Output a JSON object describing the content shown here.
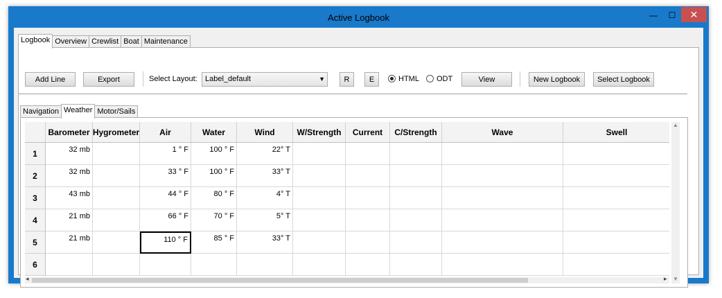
{
  "window": {
    "title": "Active Logbook",
    "minimize": "—",
    "maximize": "☐",
    "close": "✕"
  },
  "tabs": [
    "Logbook",
    "Overview",
    "Crewlist",
    "Boat",
    "Maintenance"
  ],
  "toolbar": {
    "add_line": "Add Line",
    "export": "Export",
    "select_layout_label": "Select Layout:",
    "layout_value": "Label_default",
    "r_button": "R",
    "e_button": "E",
    "html_label": "HTML",
    "odt_label": "ODT",
    "view": "View",
    "new_logbook": "New Logbook",
    "select_logbook": "Select Logbook"
  },
  "subtabs": [
    "Navigation",
    "Weather",
    "Motor/Sails"
  ],
  "grid": {
    "columns": [
      "Barometer",
      "Hygrometer",
      "Air",
      "Water",
      "Wind",
      "W/Strength",
      "Current",
      "C/Strength",
      "Wave",
      "Swell"
    ],
    "rows": [
      {
        "num": "1",
        "cells": [
          "32 mb",
          "",
          "1 ° F",
          "100 ° F",
          "22° T",
          "",
          "",
          "",
          "",
          ""
        ]
      },
      {
        "num": "2",
        "cells": [
          "32 mb",
          "",
          "33 ° F",
          "100 ° F",
          "33° T",
          "",
          "",
          "",
          "",
          ""
        ]
      },
      {
        "num": "3",
        "cells": [
          "43 mb",
          "",
          "44 ° F",
          "80 ° F",
          "4° T",
          "",
          "",
          "",
          "",
          ""
        ]
      },
      {
        "num": "4",
        "cells": [
          "21 mb",
          "",
          "66 ° F",
          "70 ° F",
          "5° T",
          "",
          "",
          "",
          "",
          ""
        ]
      },
      {
        "num": "5",
        "cells": [
          "21 mb",
          "",
          "110 ° F",
          "85 ° F",
          "33° T",
          "",
          "",
          "",
          "",
          ""
        ]
      },
      {
        "num": "6",
        "cells": [
          "",
          "",
          "",
          "",
          "",
          "",
          "",
          "",
          "",
          ""
        ]
      }
    ]
  }
}
